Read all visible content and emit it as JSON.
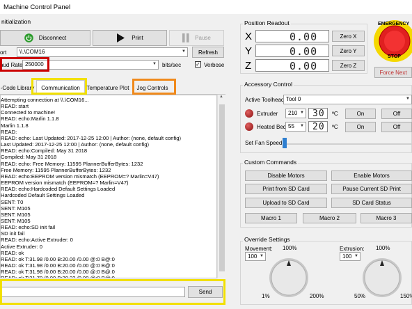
{
  "window": {
    "title": "Machine Control Panel"
  },
  "initialization": {
    "group_label": "nitialization",
    "disconnect_label": "Disconnect",
    "print_label": "Print",
    "pause_label": "Pause",
    "port_label": "ort",
    "port_value": "\\\\.\\COM16",
    "refresh_label": "Refresh",
    "baud_label": "aud Rate",
    "baud_value": "250000",
    "bits_label": "bits/sec",
    "verbose_label": "Verbose",
    "verbose_checked": "✓"
  },
  "tabs": [
    {
      "label": "-Code Library"
    },
    {
      "label": "Communication"
    },
    {
      "label": "Temperature Plot"
    },
    {
      "label": "Jog Controls"
    }
  ],
  "log": [
    "Attempting connection at \\\\.\\COM16...",
    "READ: start",
    " Connected to machine!",
    "READ: echo:Marlin 1.1.8",
    "Marlin 1.1.8",
    "READ:",
    "READ: echo: Last Updated: 2017-12-25 12:00 | Author: (none, default config)",
    "Last Updated: 2017-12-25 12:00 | Author: (none, default config)",
    "READ: echo:Compiled: May 31 2018",
    "Compiled: May 31 2018",
    "READ: echo: Free Memory: 11595  PlannerBufferBytes: 1232",
    "Free Memory: 11595  PlannerBufferBytes: 1232",
    "READ: echo:EEPROM version mismatch (EEPROM=? Marlin=V47)",
    "EEPROM version mismatch (EEPROM=? Marlin=V47)",
    "READ: echo:Hardcoded Default Settings Loaded",
    "Hardcoded Default Settings Loaded",
    "SENT: T0",
    "SENT: M105",
    "SENT: M105",
    "SENT: M105",
    "READ: echo:SD init fail",
    "SD init fail",
    "READ: echo:Active Extruder: 0",
    "Active Extruder: 0",
    "READ: ok",
    "READ: ok T:31.98 /0.00 B:20.00 /0.00 @:0 B@:0",
    "READ: ok T:31.98 /0.00 B:20.00 /0.00 @:0 B@:0",
    "READ: ok T:31.98 /0.00 B:20.00 /0.00 @:0 B@:0",
    "READ: ok T:31.70 /0.00 B:20.23 /0.00 @:0 B@:0"
  ],
  "send": {
    "input_value": "",
    "button_label": "Send"
  },
  "position": {
    "group_label": "Position Readout",
    "x_label": "X",
    "y_label": "Y",
    "z_label": "Z",
    "x_value": "0.00",
    "y_value": "0.00",
    "z_value": "0.00",
    "zero_x": "Zero X",
    "zero_y": "Zero Y",
    "zero_z": "Zero Z"
  },
  "emergency": {
    "top_text": "EMERGENCY",
    "bottom_text": "STOP",
    "force_next_label": "Force Next"
  },
  "accessory": {
    "group_label": "Accessory Control",
    "toolhead_label": "Active Toolhead",
    "toolhead_value": "Tool 0",
    "extruder_label": "Extruder",
    "extruder_target": "210",
    "extruder_temp": "30",
    "heatedbed_label": "Heated Bed",
    "heatedbed_target": "55",
    "heatedbed_temp": "20",
    "unit": "ºC",
    "on_label": "On",
    "off_label": "Off",
    "fan_label": "Set Fan Speed"
  },
  "custom": {
    "group_label": "Custom Commands",
    "buttons": [
      "Disable Motors",
      "Enable Motors",
      "Print from SD Card",
      "Pause Current SD Print",
      "Upload to SD Card",
      "SD Card Status",
      "Macro 1",
      "Macro 2",
      "Macro 3"
    ]
  },
  "override": {
    "group_label": "Override Settings",
    "movement_label": "Movement:",
    "movement_value": "100",
    "movement_center": "100%",
    "movement_min": "1%",
    "movement_max": "200%",
    "extrusion_label": "Extrusion:",
    "extrusion_value": "100",
    "extrusion_center": "100%",
    "extrusion_min": "50%",
    "extrusion_max": "150%"
  },
  "colors": {
    "highlight_red": "#cc0000",
    "highlight_yellow": "#f2e000",
    "highlight_orange": "#f08a1c",
    "disconnect_icon": "#2a9a2a",
    "emergency_red": "#e02020",
    "emergency_yellow": "#f5d800",
    "force_next_text": "#c03030"
  }
}
